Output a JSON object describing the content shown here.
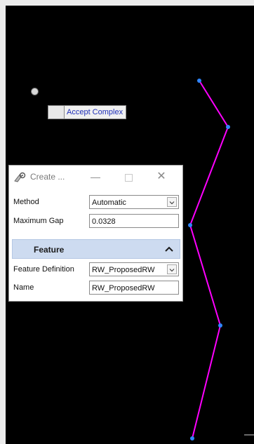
{
  "canvas": {
    "line_color": "#ff00ff",
    "vertex_color": "#1e90ff",
    "background": "#000000"
  },
  "tooltip": {
    "text": "Accept Complex"
  },
  "dialog": {
    "title": "Create ...",
    "method_label": "Method",
    "method_value": "Automatic",
    "max_gap_label": "Maximum Gap",
    "max_gap_value": "0.0328",
    "section_title": "Feature",
    "feature_def_label": "Feature Definition",
    "feature_def_value": "RW_ProposedRW",
    "name_label": "Name",
    "name_value": "RW_ProposedRW"
  }
}
